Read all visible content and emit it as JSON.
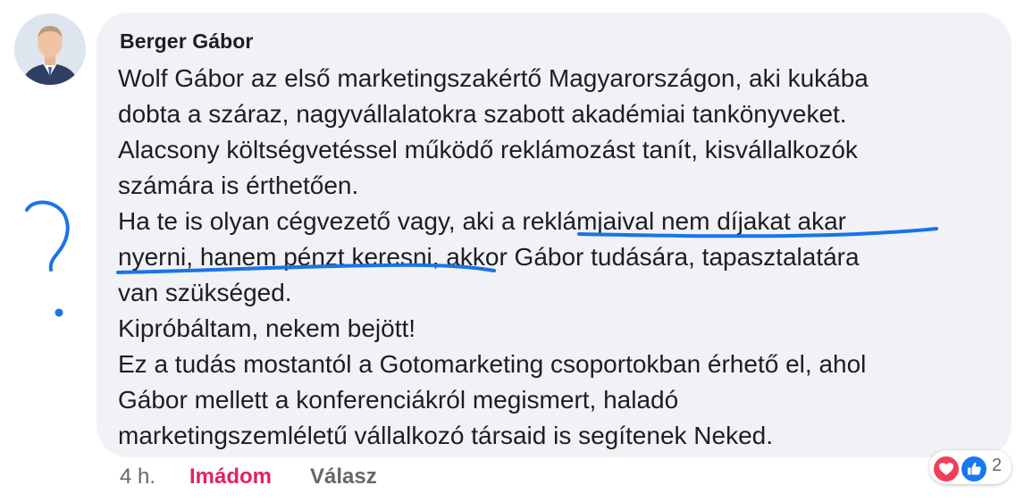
{
  "comment": {
    "author": "Berger Gábor",
    "lines": [
      "Wolf Gábor az első marketingszakértő Magyarországon, aki kukába",
      "dobta a száraz, nagyvállalatokra szabott akadémiai tankönyveket.",
      "Alacsony költségvetéssel működő reklámozást tanít, kisvállalkozók",
      "számára is érthetően.",
      "Ha te is olyan cégvezető vagy, aki a reklámjaival nem díjakat akar",
      "nyerni, hanem pénzt keresni, akkor Gábor tudására, tapasztalatára",
      "van szükséged.",
      "Kipróbáltam, nekem bejött!",
      "Ez a tudás mostantól a Gotomarketing csoportokban érhető el, ahol",
      "Gábor mellett a konferenciákról megismert, haladó",
      "marketingszemléletű vállalkozó társaid is segítenek Neked."
    ]
  },
  "actions": {
    "timestamp": "4 h.",
    "love_label": "Imádom",
    "reply_label": "Válasz"
  },
  "reactions": {
    "icons": [
      "heart-icon",
      "like-icon"
    ],
    "count": "2"
  },
  "annotation": {
    "symbol_icon": "handwritten-question-mark",
    "ink_color": "#1a73e8"
  },
  "colors": {
    "bubble": "#f0f2f5",
    "love": "#e0245e",
    "like": "#1877f2",
    "heart": "#f33e58"
  }
}
